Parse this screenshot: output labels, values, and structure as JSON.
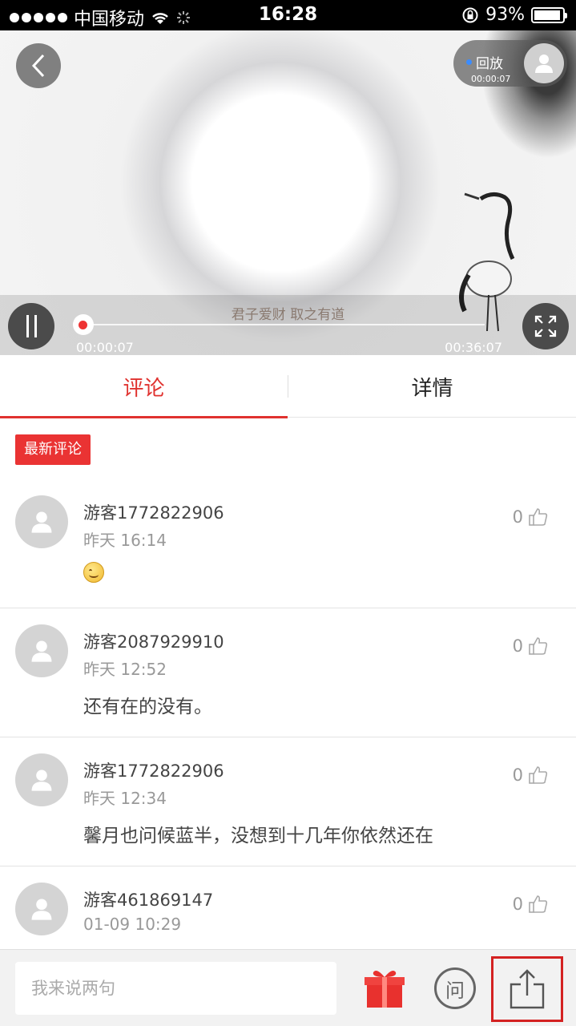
{
  "status_bar": {
    "carrier": "中国移动",
    "time": "16:28",
    "battery": "93%",
    "battery_level": 0.93
  },
  "video": {
    "replay_label": "回放",
    "replay_time": "00:00:07",
    "subtitle": "君子爱财  取之有道",
    "current_time": "00:00:07",
    "total_time": "00:36:07",
    "progress": 0.003
  },
  "tabs": [
    {
      "label": "评论",
      "active": true
    },
    {
      "label": "详情",
      "active": false
    }
  ],
  "latest_badge": "最新评论",
  "comments": [
    {
      "user": "游客1772822906",
      "time": "昨天 16:14",
      "text": "",
      "emoji": "smile",
      "likes": "0"
    },
    {
      "user": "游客2087929910",
      "time": "昨天 12:52",
      "text": "还有在的没有。",
      "likes": "0"
    },
    {
      "user": "游客1772822906",
      "time": "昨天 12:34",
      "text": "馨月也问候蓝半，没想到十几年你依然还在",
      "likes": "0"
    },
    {
      "user": "游客461869147",
      "time": "01-09 10:29",
      "text": "",
      "likes": "0"
    }
  ],
  "bottom_bar": {
    "input_placeholder": "我来说两句",
    "ask_label": "问"
  },
  "colors": {
    "accent": "#e0322f",
    "badge": "#ea3333",
    "highlight_box": "#d42222"
  },
  "icons": [
    "back-arrow-icon",
    "user-icon",
    "pause-icon",
    "fullscreen-icon",
    "thumbs-up-icon",
    "gift-icon",
    "share-icon"
  ]
}
